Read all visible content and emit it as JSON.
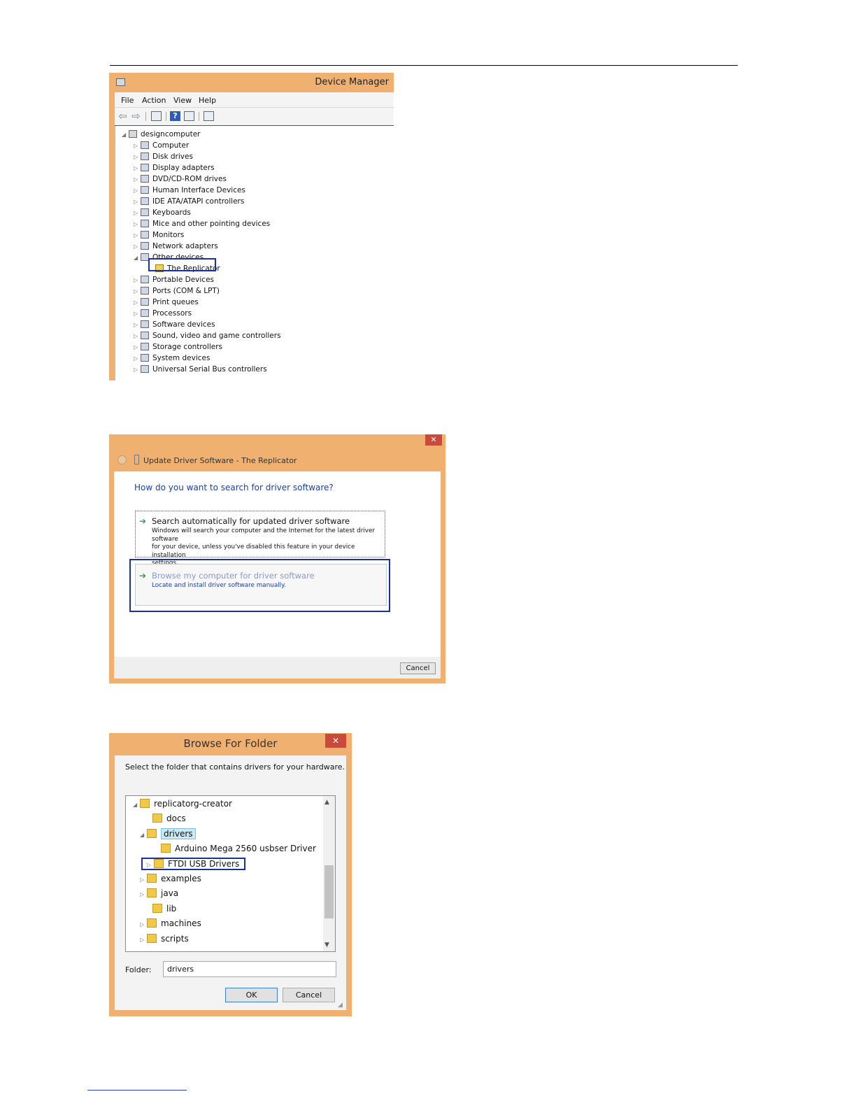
{
  "device_manager": {
    "title": "Device Manager",
    "menu": [
      "File",
      "Action",
      "View",
      "Help"
    ],
    "toolbar_icons": [
      "back-arrow-icon",
      "forward-arrow-icon",
      "properties-icon",
      "help-icon",
      "show-hidden-icon",
      "scan-hardware-icon"
    ],
    "tree": {
      "root": "designcomputer",
      "items": [
        {
          "label": "Computer"
        },
        {
          "label": "Disk drives"
        },
        {
          "label": "Display adapters"
        },
        {
          "label": "DVD/CD-ROM drives"
        },
        {
          "label": "Human Interface Devices"
        },
        {
          "label": "IDE ATA/ATAPI controllers"
        },
        {
          "label": "Keyboards"
        },
        {
          "label": "Mice and other pointing devices"
        },
        {
          "label": "Monitors"
        },
        {
          "label": "Network adapters"
        },
        {
          "label": "Other devices",
          "expanded": true
        },
        {
          "label": "The Replicator",
          "child": true,
          "warning": true,
          "highlighted": true
        },
        {
          "label": "Portable Devices"
        },
        {
          "label": "Ports (COM & LPT)"
        },
        {
          "label": "Print queues"
        },
        {
          "label": "Processors"
        },
        {
          "label": "Software devices"
        },
        {
          "label": "Sound, video and game controllers"
        },
        {
          "label": "Storage controllers"
        },
        {
          "label": "System devices"
        },
        {
          "label": "Universal Serial Bus controllers"
        }
      ]
    }
  },
  "update_driver": {
    "title": "Update Driver Software - The Replicator",
    "question": "How do you want to search for driver software?",
    "option_auto": {
      "title": "Search automatically for updated driver software",
      "description_lines": [
        "Windows will search your computer and the Internet for the latest driver software",
        "for your device, unless you've disabled this feature in your device installation",
        "settings."
      ]
    },
    "option_browse": {
      "title": "Browse my computer for driver software",
      "description": "Locate and install driver software manually.",
      "highlighted": true
    },
    "cancel_label": "Cancel",
    "close_glyph": "✕"
  },
  "browse_folder": {
    "title": "Browse For Folder",
    "instruction": "Select the folder that contains drivers for your hardware.",
    "tree": [
      {
        "label": "replicatorg-creator",
        "expander": "◢"
      },
      {
        "label": "docs",
        "expander": ""
      },
      {
        "label": "drivers",
        "expander": "◢",
        "selected": true
      },
      {
        "label": "Arduino Mega 2560 usbser Driver",
        "expander": ""
      },
      {
        "label": "FTDI USB Drivers",
        "expander": "▷",
        "highlighted": true
      },
      {
        "label": "examples",
        "expander": "▷"
      },
      {
        "label": "java",
        "expander": "▷"
      },
      {
        "label": "lib",
        "expander": ""
      },
      {
        "label": "machines",
        "expander": "▷"
      },
      {
        "label": "scripts",
        "expander": "▷"
      }
    ],
    "folder_label": "Folder:",
    "folder_value": "drivers",
    "ok_label": "OK",
    "cancel_label": "Cancel",
    "close_glyph": "✕"
  },
  "colors": {
    "window_frame": "#f0b070",
    "highlight_box": "#1b2fa0",
    "link_blue": "#1d3f9e",
    "close_red": "#c94a3a"
  }
}
